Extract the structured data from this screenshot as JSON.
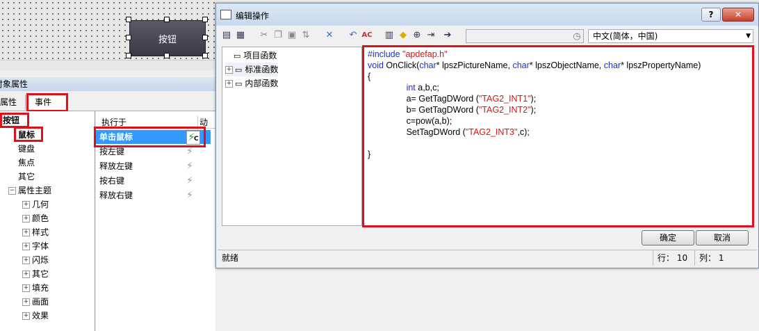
{
  "canvas": {
    "widget_label": "按钮"
  },
  "properties_panel": {
    "title": "对象属性",
    "tabs": [
      "属性",
      "事件"
    ],
    "tree": {
      "root": "按钮",
      "items": [
        "鼠标",
        "键盘",
        "焦点",
        "其它"
      ],
      "group": "属性主题",
      "group_items": [
        "几何",
        "颜色",
        "样式",
        "字体",
        "闪烁",
        "其它",
        "填充",
        "画面",
        "效果"
      ]
    },
    "events_header": {
      "col1": "执行于",
      "col2": "动作"
    },
    "events": [
      {
        "label": "单击鼠标",
        "action_badge": "C"
      },
      {
        "label": "按左键"
      },
      {
        "label": "释放左键"
      },
      {
        "label": "按右键"
      },
      {
        "label": "释放右键"
      }
    ]
  },
  "dialog": {
    "title": "编辑操作",
    "help_button": "?",
    "close_button": "✕",
    "toolbar": {
      "icons": [
        "compile-icon",
        "compile-all-icon",
        "cut-icon",
        "copy-icon",
        "paste-icon",
        "format-icon",
        "delete-icon",
        "undo-icon",
        "color-code-icon",
        "grid-icon",
        "cube-icon",
        "import-icon",
        "export-icon",
        "arrow-icon"
      ],
      "search_value": "",
      "language_select": "中文(简体，中国)"
    },
    "function_tree": [
      "项目函数",
      "标准函数",
      "内部函数"
    ],
    "code_lines": [
      [
        {
          "t": "#include ",
          "c": "kw"
        },
        {
          "t": "\"apdefap.h\"",
          "c": "str"
        }
      ],
      [
        {
          "t": "void",
          "c": "kw"
        },
        {
          "t": " OnClick(",
          "c": ""
        },
        {
          "t": "char",
          "c": "kw"
        },
        {
          "t": "* lpszPictureName, ",
          "c": ""
        },
        {
          "t": "char",
          "c": "kw"
        },
        {
          "t": "* lpszObjectName, ",
          "c": ""
        },
        {
          "t": "char",
          "c": "kw"
        },
        {
          "t": "* lpszPropertyName)",
          "c": ""
        }
      ],
      [
        {
          "t": "{",
          "c": ""
        }
      ],
      [
        {
          "t": "                int",
          "c": "kw"
        },
        {
          "t": " a,b,c;",
          "c": ""
        }
      ],
      [
        {
          "t": "                a= GetTagDWord (",
          "c": ""
        },
        {
          "t": "\"TAG2_INT1\"",
          "c": "str"
        },
        {
          "t": ");",
          "c": ""
        }
      ],
      [
        {
          "t": "                b= GetTagDWord (",
          "c": ""
        },
        {
          "t": "\"TAG2_INT2\"",
          "c": "str"
        },
        {
          "t": ");",
          "c": ""
        }
      ],
      [
        {
          "t": "                c=pow(a,b);",
          "c": ""
        }
      ],
      [
        {
          "t": "                SetTagDWord (",
          "c": ""
        },
        {
          "t": "\"TAG2_INT3\"",
          "c": "str"
        },
        {
          "t": ",c);",
          "c": ""
        }
      ],
      [
        {
          "t": "",
          "c": ""
        }
      ],
      [
        {
          "t": "}",
          "c": ""
        }
      ]
    ],
    "ok_button": "确定",
    "cancel_button": "取消",
    "status_text": "就绪",
    "row_label": "行：",
    "row_value": "10",
    "col_label": "列：",
    "col_value": "1"
  }
}
